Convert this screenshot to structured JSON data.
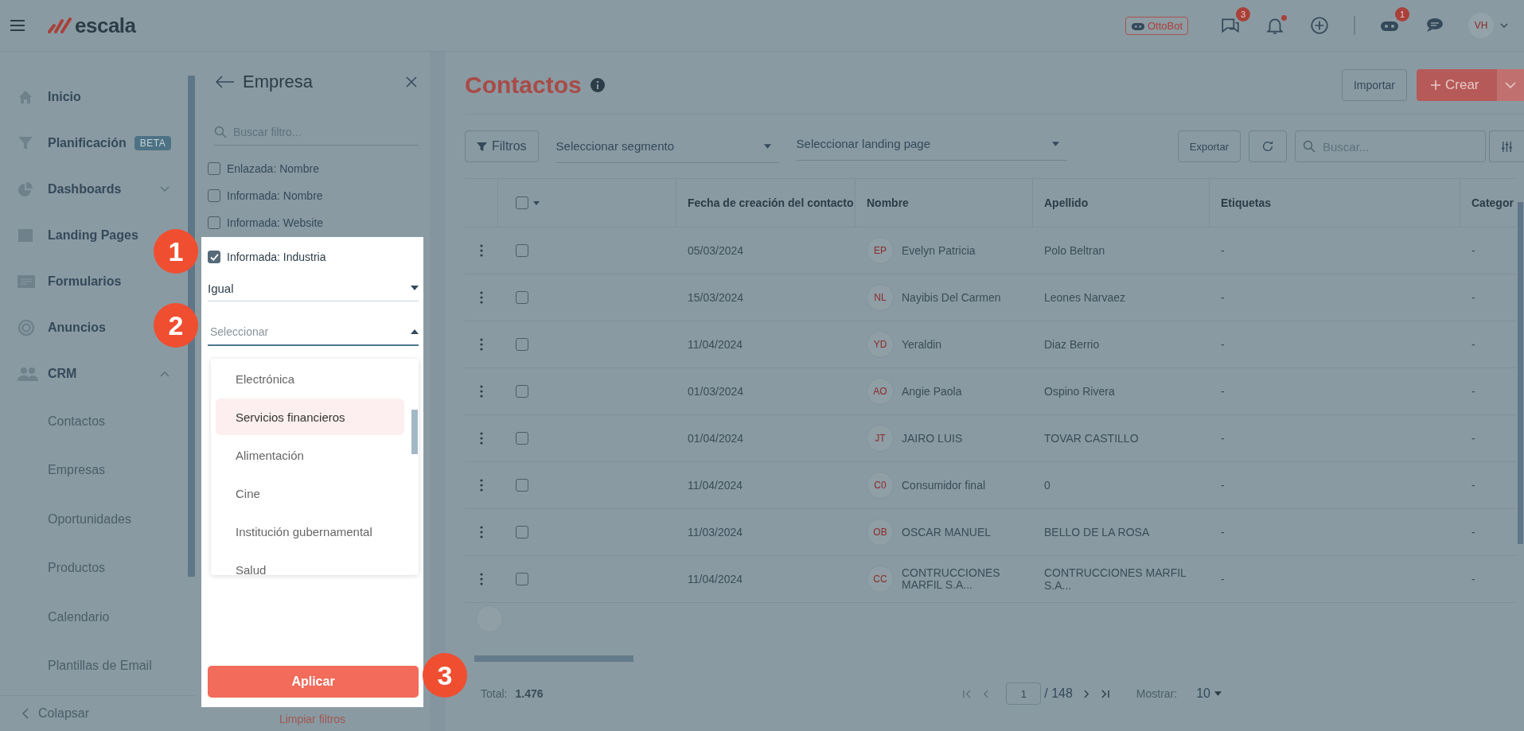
{
  "header": {
    "logo": "escala",
    "bot_label": "OttoBot",
    "chat_count": "3",
    "notifications_unread": true,
    "bot_count": "1",
    "avatar": "VH"
  },
  "sidebar": {
    "items": [
      {
        "label": "Inicio"
      },
      {
        "label": "Planificación",
        "badge": "BETA"
      },
      {
        "label": "Dashboards",
        "expanded": false
      },
      {
        "label": "Landing Pages"
      },
      {
        "label": "Formularios"
      },
      {
        "label": "Anuncios"
      },
      {
        "label": "CRM",
        "expanded": true,
        "children": [
          {
            "label": "Contactos"
          },
          {
            "label": "Empresas"
          },
          {
            "label": "Oportunidades"
          },
          {
            "label": "Productos"
          },
          {
            "label": "Calendario"
          },
          {
            "label": "Plantillas de Email"
          }
        ]
      }
    ],
    "collapse": "Colapsar"
  },
  "filter_panel": {
    "title": "Empresa",
    "search_placeholder": "Buscar filtro...",
    "filters": [
      {
        "label": "Enlazada: Nombre",
        "checked": false
      },
      {
        "label": "Informada: Nombre",
        "checked": false
      },
      {
        "label": "Informada: Website",
        "checked": false
      },
      {
        "label": "Informada: Industria",
        "checked": true
      }
    ],
    "operator": "Igual",
    "value_placeholder": "Seleccionar",
    "options": [
      {
        "label": "Electrónica",
        "selected": false
      },
      {
        "label": "Servicios financieros",
        "selected": true
      },
      {
        "label": "Alimentación",
        "selected": false
      },
      {
        "label": "Cine",
        "selected": false
      },
      {
        "label": "Institución gubernamental",
        "selected": false
      },
      {
        "label": "Salud",
        "selected": false
      }
    ],
    "apply": "Aplicar",
    "clear": "Limpiar filtros"
  },
  "callouts": [
    "1",
    "2",
    "3"
  ],
  "page": {
    "title": "Contactos",
    "import": "Importar",
    "create": "Crear",
    "filters_button": "Filtros",
    "segment_placeholder": "Seleccionar segmento",
    "landing_placeholder": "Seleccionar landing page",
    "export": "Exportar",
    "search_placeholder": "Buscar..."
  },
  "table": {
    "select_all_checked": false,
    "columns": [
      "Fecha de creación del contacto",
      "Nombre",
      "Apellido",
      "Etiquetas",
      "Categor"
    ],
    "rows": [
      {
        "checked": false,
        "date": "05/03/2024",
        "initials": "EP",
        "name": "Evelyn Patricia",
        "surname": "Polo Beltran",
        "tags": "-",
        "category": "-"
      },
      {
        "checked": false,
        "date": "15/03/2024",
        "initials": "NL",
        "name": "Nayibis Del Carmen",
        "surname": "Leones Narvaez",
        "tags": "-",
        "category": "-"
      },
      {
        "checked": false,
        "date": "11/04/2024",
        "initials": "YD",
        "name": "Yeraldin",
        "surname": "Diaz Berrio",
        "tags": "-",
        "category": "-"
      },
      {
        "checked": false,
        "date": "01/03/2024",
        "initials": "AO",
        "name": "Angie Paola",
        "surname": "Ospino Rivera",
        "tags": "-",
        "category": "-"
      },
      {
        "checked": false,
        "date": "01/04/2024",
        "initials": "JT",
        "name": "JAIRO LUIS",
        "surname": "TOVAR CASTILLO",
        "tags": "-",
        "category": "-"
      },
      {
        "checked": false,
        "date": "11/04/2024",
        "initials": "C0",
        "name": "Consumidor final",
        "surname": "0",
        "tags": "-",
        "category": "-"
      },
      {
        "checked": false,
        "date": "11/03/2024",
        "initials": "OB",
        "name": "OSCAR MANUEL",
        "surname": "BELLO DE LA ROSA",
        "tags": "-",
        "category": "-"
      },
      {
        "checked": false,
        "date": "11/04/2024",
        "initials": "CC",
        "name": "CONTRUCCIONES MARFIL S.A...",
        "surname": "CONTRUCCIONES MARFIL S.A...",
        "tags": "-",
        "category": "-"
      }
    ]
  },
  "footer": {
    "total_label": "Total:",
    "total": "1.476",
    "page": "1",
    "pages": "/ 148",
    "show_label": "Mostrar:",
    "page_size": "10"
  }
}
